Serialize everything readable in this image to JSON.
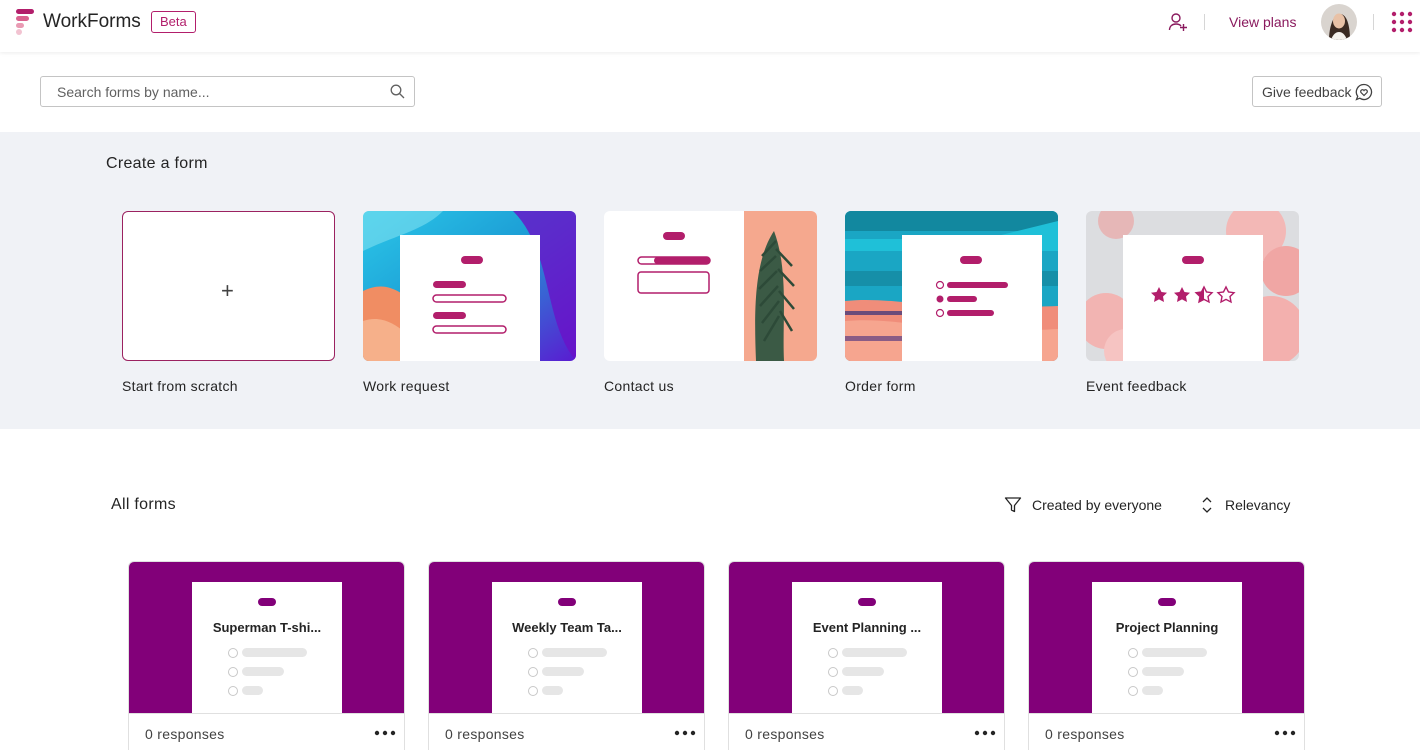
{
  "header": {
    "app_title": "WorkForms",
    "badge": "Beta",
    "view_plans": "View plans",
    "icons": [
      "logo-icon",
      "add-user-icon",
      "avatar",
      "app-launcher-icon"
    ]
  },
  "search": {
    "placeholder": "Search forms by name...",
    "value": ""
  },
  "feedback_button": "Give feedback",
  "create": {
    "title": "Create a form",
    "templates": [
      {
        "label": "Start from scratch"
      },
      {
        "label": "Work request"
      },
      {
        "label": "Contact us"
      },
      {
        "label": "Order form"
      },
      {
        "label": "Event feedback"
      }
    ]
  },
  "all_forms": {
    "title": "All forms",
    "filter": "Created by everyone",
    "sort": "Relevancy",
    "forms": [
      {
        "name": "Superman T-shi...",
        "responses": "0 responses"
      },
      {
        "name": "Weekly Team Ta...",
        "responses": "0 responses"
      },
      {
        "name": "Event Planning ...",
        "responses": "0 responses"
      },
      {
        "name": "Project Planning",
        "responses": "0 responses"
      }
    ]
  },
  "colors": {
    "accent": "#b21e6b",
    "form_banner": "#820079",
    "section_bg": "#f0f2f6"
  }
}
